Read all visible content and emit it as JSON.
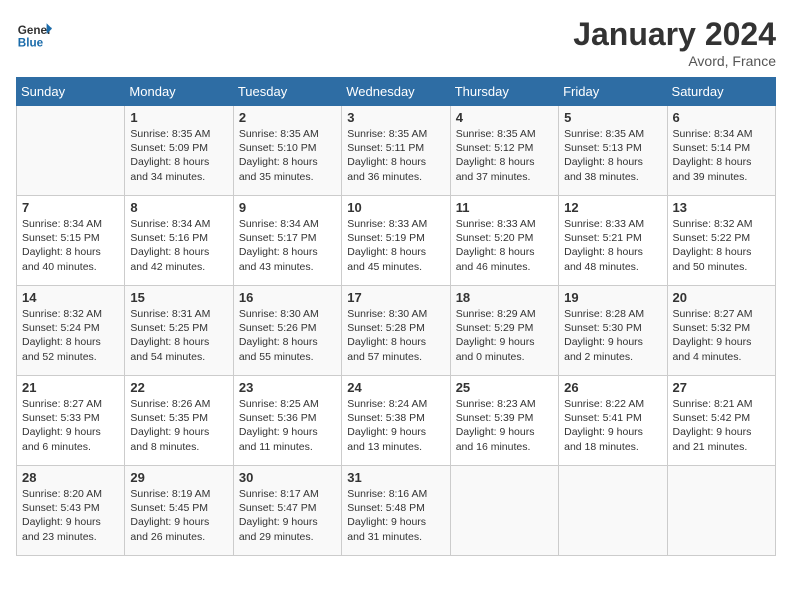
{
  "header": {
    "logo_line1": "General",
    "logo_line2": "Blue",
    "month": "January 2024",
    "location": "Avord, France"
  },
  "weekdays": [
    "Sunday",
    "Monday",
    "Tuesday",
    "Wednesday",
    "Thursday",
    "Friday",
    "Saturday"
  ],
  "weeks": [
    [
      {
        "day": "",
        "sunrise": "",
        "sunset": "",
        "daylight": ""
      },
      {
        "day": "1",
        "sunrise": "Sunrise: 8:35 AM",
        "sunset": "Sunset: 5:09 PM",
        "daylight": "Daylight: 8 hours and 34 minutes."
      },
      {
        "day": "2",
        "sunrise": "Sunrise: 8:35 AM",
        "sunset": "Sunset: 5:10 PM",
        "daylight": "Daylight: 8 hours and 35 minutes."
      },
      {
        "day": "3",
        "sunrise": "Sunrise: 8:35 AM",
        "sunset": "Sunset: 5:11 PM",
        "daylight": "Daylight: 8 hours and 36 minutes."
      },
      {
        "day": "4",
        "sunrise": "Sunrise: 8:35 AM",
        "sunset": "Sunset: 5:12 PM",
        "daylight": "Daylight: 8 hours and 37 minutes."
      },
      {
        "day": "5",
        "sunrise": "Sunrise: 8:35 AM",
        "sunset": "Sunset: 5:13 PM",
        "daylight": "Daylight: 8 hours and 38 minutes."
      },
      {
        "day": "6",
        "sunrise": "Sunrise: 8:34 AM",
        "sunset": "Sunset: 5:14 PM",
        "daylight": "Daylight: 8 hours and 39 minutes."
      }
    ],
    [
      {
        "day": "7",
        "sunrise": "Sunrise: 8:34 AM",
        "sunset": "Sunset: 5:15 PM",
        "daylight": "Daylight: 8 hours and 40 minutes."
      },
      {
        "day": "8",
        "sunrise": "Sunrise: 8:34 AM",
        "sunset": "Sunset: 5:16 PM",
        "daylight": "Daylight: 8 hours and 42 minutes."
      },
      {
        "day": "9",
        "sunrise": "Sunrise: 8:34 AM",
        "sunset": "Sunset: 5:17 PM",
        "daylight": "Daylight: 8 hours and 43 minutes."
      },
      {
        "day": "10",
        "sunrise": "Sunrise: 8:33 AM",
        "sunset": "Sunset: 5:19 PM",
        "daylight": "Daylight: 8 hours and 45 minutes."
      },
      {
        "day": "11",
        "sunrise": "Sunrise: 8:33 AM",
        "sunset": "Sunset: 5:20 PM",
        "daylight": "Daylight: 8 hours and 46 minutes."
      },
      {
        "day": "12",
        "sunrise": "Sunrise: 8:33 AM",
        "sunset": "Sunset: 5:21 PM",
        "daylight": "Daylight: 8 hours and 48 minutes."
      },
      {
        "day": "13",
        "sunrise": "Sunrise: 8:32 AM",
        "sunset": "Sunset: 5:22 PM",
        "daylight": "Daylight: 8 hours and 50 minutes."
      }
    ],
    [
      {
        "day": "14",
        "sunrise": "Sunrise: 8:32 AM",
        "sunset": "Sunset: 5:24 PM",
        "daylight": "Daylight: 8 hours and 52 minutes."
      },
      {
        "day": "15",
        "sunrise": "Sunrise: 8:31 AM",
        "sunset": "Sunset: 5:25 PM",
        "daylight": "Daylight: 8 hours and 54 minutes."
      },
      {
        "day": "16",
        "sunrise": "Sunrise: 8:30 AM",
        "sunset": "Sunset: 5:26 PM",
        "daylight": "Daylight: 8 hours and 55 minutes."
      },
      {
        "day": "17",
        "sunrise": "Sunrise: 8:30 AM",
        "sunset": "Sunset: 5:28 PM",
        "daylight": "Daylight: 8 hours and 57 minutes."
      },
      {
        "day": "18",
        "sunrise": "Sunrise: 8:29 AM",
        "sunset": "Sunset: 5:29 PM",
        "daylight": "Daylight: 9 hours and 0 minutes."
      },
      {
        "day": "19",
        "sunrise": "Sunrise: 8:28 AM",
        "sunset": "Sunset: 5:30 PM",
        "daylight": "Daylight: 9 hours and 2 minutes."
      },
      {
        "day": "20",
        "sunrise": "Sunrise: 8:27 AM",
        "sunset": "Sunset: 5:32 PM",
        "daylight": "Daylight: 9 hours and 4 minutes."
      }
    ],
    [
      {
        "day": "21",
        "sunrise": "Sunrise: 8:27 AM",
        "sunset": "Sunset: 5:33 PM",
        "daylight": "Daylight: 9 hours and 6 minutes."
      },
      {
        "day": "22",
        "sunrise": "Sunrise: 8:26 AM",
        "sunset": "Sunset: 5:35 PM",
        "daylight": "Daylight: 9 hours and 8 minutes."
      },
      {
        "day": "23",
        "sunrise": "Sunrise: 8:25 AM",
        "sunset": "Sunset: 5:36 PM",
        "daylight": "Daylight: 9 hours and 11 minutes."
      },
      {
        "day": "24",
        "sunrise": "Sunrise: 8:24 AM",
        "sunset": "Sunset: 5:38 PM",
        "daylight": "Daylight: 9 hours and 13 minutes."
      },
      {
        "day": "25",
        "sunrise": "Sunrise: 8:23 AM",
        "sunset": "Sunset: 5:39 PM",
        "daylight": "Daylight: 9 hours and 16 minutes."
      },
      {
        "day": "26",
        "sunrise": "Sunrise: 8:22 AM",
        "sunset": "Sunset: 5:41 PM",
        "daylight": "Daylight: 9 hours and 18 minutes."
      },
      {
        "day": "27",
        "sunrise": "Sunrise: 8:21 AM",
        "sunset": "Sunset: 5:42 PM",
        "daylight": "Daylight: 9 hours and 21 minutes."
      }
    ],
    [
      {
        "day": "28",
        "sunrise": "Sunrise: 8:20 AM",
        "sunset": "Sunset: 5:43 PM",
        "daylight": "Daylight: 9 hours and 23 minutes."
      },
      {
        "day": "29",
        "sunrise": "Sunrise: 8:19 AM",
        "sunset": "Sunset: 5:45 PM",
        "daylight": "Daylight: 9 hours and 26 minutes."
      },
      {
        "day": "30",
        "sunrise": "Sunrise: 8:17 AM",
        "sunset": "Sunset: 5:47 PM",
        "daylight": "Daylight: 9 hours and 29 minutes."
      },
      {
        "day": "31",
        "sunrise": "Sunrise: 8:16 AM",
        "sunset": "Sunset: 5:48 PM",
        "daylight": "Daylight: 9 hours and 31 minutes."
      },
      {
        "day": "",
        "sunrise": "",
        "sunset": "",
        "daylight": ""
      },
      {
        "day": "",
        "sunrise": "",
        "sunset": "",
        "daylight": ""
      },
      {
        "day": "",
        "sunrise": "",
        "sunset": "",
        "daylight": ""
      }
    ]
  ]
}
